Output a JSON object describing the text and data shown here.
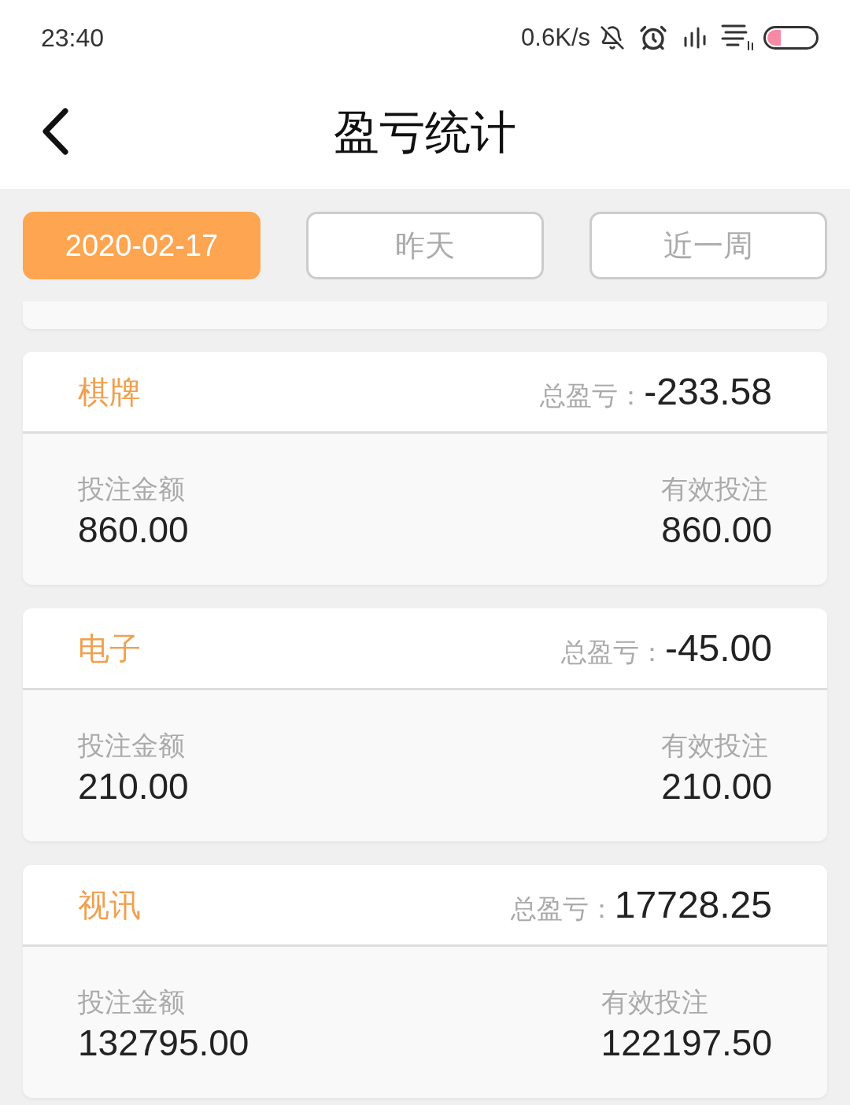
{
  "status_bar": {
    "time": "23:40",
    "network_speed": "0.6K/s"
  },
  "header": {
    "title": "盈亏统计"
  },
  "tabs": [
    {
      "label": "2020-02-17",
      "selected": true
    },
    {
      "label": "昨天",
      "selected": false
    },
    {
      "label": "近一周",
      "selected": false
    }
  ],
  "cards": [
    {
      "category": "棋牌",
      "total_label": "总盈亏：",
      "total": "-233.58",
      "stats": [
        {
          "label": "投注金额",
          "value": "860.00"
        },
        {
          "label": "有效投注",
          "value": "860.00"
        }
      ]
    },
    {
      "category": "电子",
      "total_label": "总盈亏：",
      "total": "-45.00",
      "stats": [
        {
          "label": "投注金额",
          "value": "210.00"
        },
        {
          "label": "有效投注",
          "value": "210.00"
        }
      ]
    },
    {
      "category": "视讯",
      "total_label": "总盈亏：",
      "total": "17728.25",
      "stats": [
        {
          "label": "投注金额",
          "value": "132795.00"
        },
        {
          "label": "有效投注",
          "value": "122197.50"
        }
      ]
    }
  ]
}
